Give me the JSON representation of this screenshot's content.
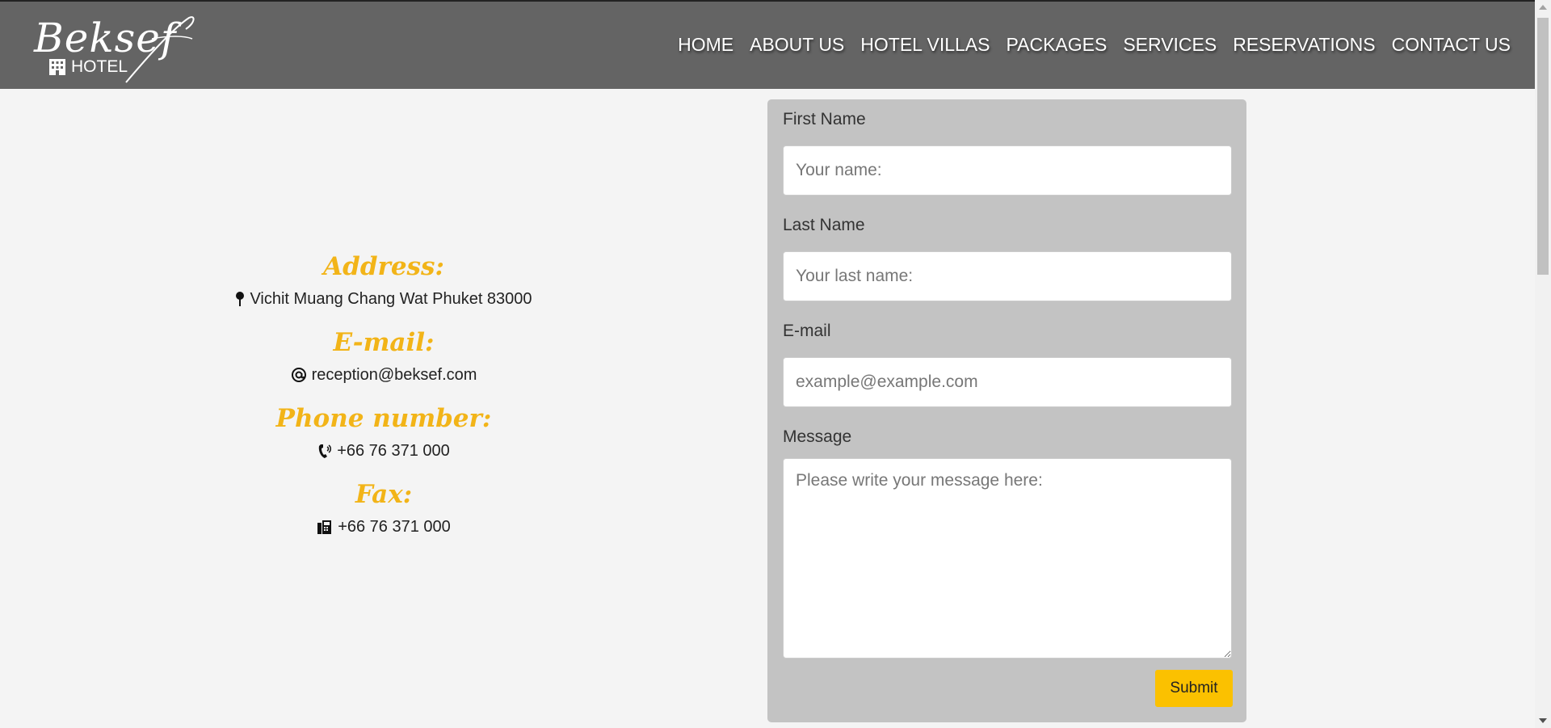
{
  "brand": {
    "script": "Beksef",
    "subtitle": "HOTEL"
  },
  "nav": {
    "items": [
      "HOME",
      "ABOUT US",
      "HOTEL VILLAS",
      "PACKAGES",
      "SERVICES",
      "RESERVATIONS",
      "CONTACT US"
    ]
  },
  "contact": {
    "address_heading": "Address:",
    "address_value": "Vichit Muang Chang Wat Phuket 83000",
    "email_heading": "E-mail:",
    "email_value": "reception@beksef.com",
    "phone_heading": "Phone number:",
    "phone_value": "+66 76 371 000",
    "fax_heading": "Fax:",
    "fax_value": "+66 76 371 000"
  },
  "form": {
    "first_name_label": "First Name",
    "first_name_placeholder": "Your name:",
    "last_name_label": "Last Name",
    "last_name_placeholder": "Your last name:",
    "email_label": "E-mail",
    "email_placeholder": "example@example.com",
    "message_label": "Message",
    "message_placeholder": "Please write your message here:",
    "submit_label": "Submit"
  },
  "colors": {
    "header_bg": "#646464",
    "accent_heading": "#f2b418",
    "submit_bg": "#fbc100",
    "form_bg": "#c3c3c3",
    "page_bg": "#f4f4f4"
  },
  "icons": [
    "map-pin-icon",
    "at-icon",
    "phone-icon",
    "fax-icon",
    "building-icon"
  ]
}
